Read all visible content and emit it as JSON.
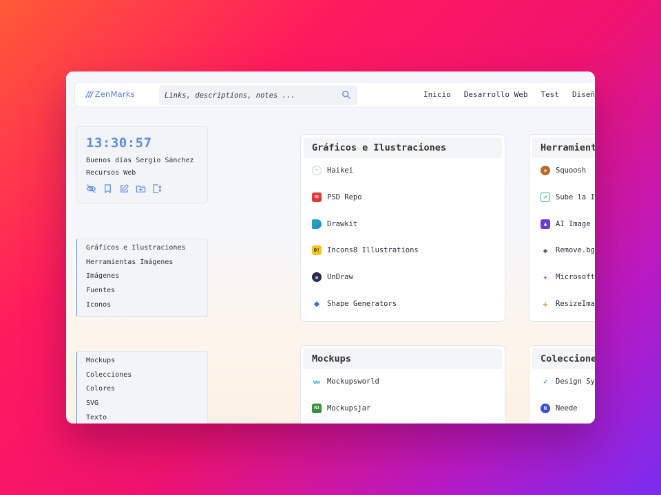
{
  "app": {
    "logo_text": "ZenMarks",
    "logo_mark": "///"
  },
  "search": {
    "placeholder": "Links, descriptions, notes ..."
  },
  "nav": [
    "Inicio",
    "Desarrollo Web",
    "Test",
    "Diseño"
  ],
  "clock": {
    "time": "13:30:57",
    "greeting": "Buenos días Sergio Sánchez",
    "collection": "Recursos Web"
  },
  "tools": [
    "eye-off-icon",
    "bookmark-icon",
    "edit-icon",
    "folder-plus-icon",
    "expand-icon"
  ],
  "sidebar": {
    "group1": [
      "Gráficos e Ilustraciones",
      "Herramientas Imágenes",
      "Imágenes",
      "Fuentes",
      "Iconos"
    ],
    "group2": [
      "Mockups",
      "Colecciones",
      "Colores",
      "SVG",
      "Texto"
    ]
  },
  "cards": [
    {
      "title": "Gráficos e Ilustraciones",
      "items": [
        {
          "label": "Haikei",
          "icon": "haikei-icon",
          "glyph": "◠",
          "color": "#bcd6f5"
        },
        {
          "label": "PSD Repo",
          "icon": "psd-repo-icon",
          "glyph": "RE",
          "color": "#e23a3a"
        },
        {
          "label": "Drawkit",
          "icon": "drawkit-icon",
          "glyph": "",
          "color": "#21b3a0"
        },
        {
          "label": "Incons8 Illustrations",
          "icon": "icons8-icon",
          "glyph": "O!",
          "color": "#f5c518"
        },
        {
          "label": "UnDraw",
          "icon": "undraw-icon",
          "glyph": "●",
          "color": "#2b2b48"
        },
        {
          "label": "Shape Generators",
          "icon": "shape-generators-icon",
          "glyph": "◆",
          "color": "#3b6cf5"
        }
      ]
    },
    {
      "title": "Herramientas Imágenes",
      "items": [
        {
          "label": "Squoosh",
          "icon": "squoosh-icon",
          "glyph": "●",
          "color": "#b86a2c"
        },
        {
          "label": "Sube la Imagen",
          "icon": "sube-la-imagen-icon",
          "glyph": "↗",
          "color": "#2fb38a"
        },
        {
          "label": "AI Image Enlarger",
          "icon": "ai-image-icon",
          "glyph": "▲",
          "color": "#6a3bd6"
        },
        {
          "label": "Remove.bg",
          "icon": "remove-bg-icon",
          "glyph": "◆",
          "color": "#55606e"
        },
        {
          "label": "Microsoft Designer",
          "icon": "microsoft-icon",
          "glyph": "✦",
          "color": "#b24df2"
        },
        {
          "label": "ResizeImage",
          "icon": "resizeimage-icon",
          "glyph": "✚",
          "color": "#f0a020"
        }
      ]
    },
    {
      "title": "Mockups",
      "items": [
        {
          "label": "Mockupsworld",
          "icon": "mockupsworld-icon",
          "glyph": "ww",
          "color": "#1fa3d6"
        },
        {
          "label": "Mockupsjar",
          "icon": "mockupsjar-icon",
          "glyph": "MJ",
          "color": "#3a8f3a"
        }
      ]
    },
    {
      "title": "Colecciones",
      "items": [
        {
          "label": "Design Systems",
          "icon": "design-systems-icon",
          "glyph": "➶",
          "color": "#2f6fd6"
        },
        {
          "label": "Neede",
          "icon": "neede-icon",
          "glyph": "N",
          "color": "#3a4fd6"
        }
      ]
    }
  ]
}
